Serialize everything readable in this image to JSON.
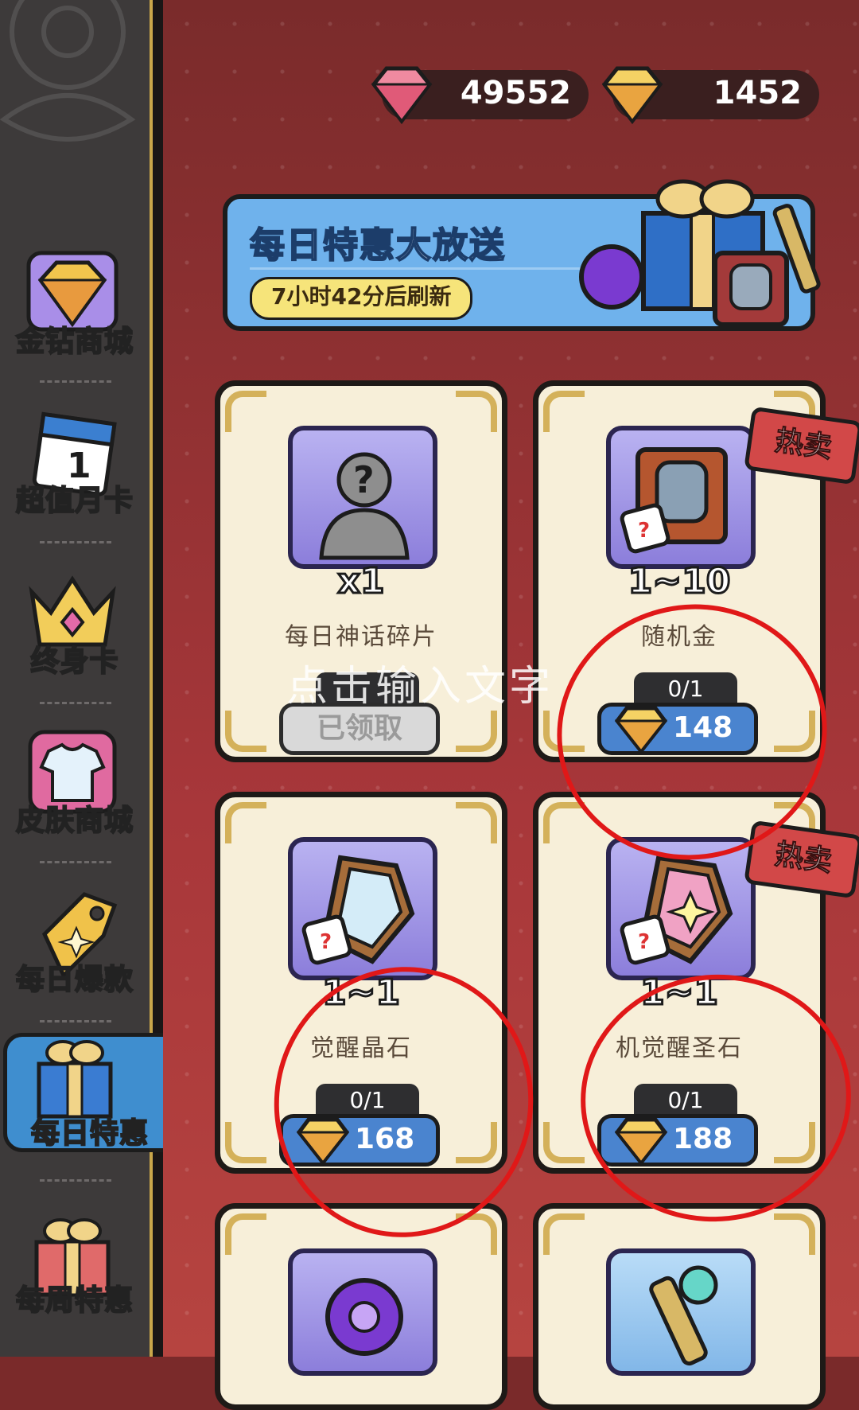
{
  "currencies": [
    {
      "name": "pink-diamond",
      "value": "49552"
    },
    {
      "name": "gold-diamond",
      "value": "1452"
    }
  ],
  "sidebar": {
    "items": [
      {
        "label": "金钻商城",
        "icon": "gold-diamond-icon"
      },
      {
        "label": "超值月卡",
        "icon": "calendar-icon"
      },
      {
        "label": "终身卡",
        "icon": "crown-icon"
      },
      {
        "label": "皮肤商城",
        "icon": "shirt-icon"
      },
      {
        "label": "每日爆款",
        "icon": "tag-icon"
      },
      {
        "label": "每日特惠",
        "icon": "gift-box-icon"
      },
      {
        "label": "每周特惠",
        "icon": "gift-box-red-icon"
      }
    ],
    "active_index": 5
  },
  "banner": {
    "title": "每日特惠大放送",
    "timer": "7小时42分后刷新"
  },
  "cards": [
    {
      "qty": "x1",
      "name": "每日神话碎片",
      "limit": "",
      "price": "",
      "claimed": "已领取",
      "hot": false,
      "icon": "mystery-hero-icon"
    },
    {
      "qty": "1~10",
      "name": "随机金",
      "limit": "0/1",
      "price": "148",
      "claimed": "",
      "hot": true,
      "icon": "random-book-icon"
    },
    {
      "qty": "1~1",
      "name": "觉醒晶石",
      "limit": "0/1",
      "price": "168",
      "claimed": "",
      "hot": false,
      "icon": "awaken-crystal-icon"
    },
    {
      "qty": "1~1",
      "name": "机觉醒圣石",
      "limit": "0/1",
      "price": "188",
      "claimed": "",
      "hot": true,
      "icon": "awaken-holy-stone-icon"
    }
  ],
  "hot_label": "热卖",
  "overlay_text": "点击输入文字",
  "colors": {
    "sidebar_bg": "#3d3a3a",
    "main_bg": "#a8373a",
    "banner_bg": "#6fb2ec",
    "price_button": "#4a84cf",
    "annotation_red": "#e01818"
  }
}
